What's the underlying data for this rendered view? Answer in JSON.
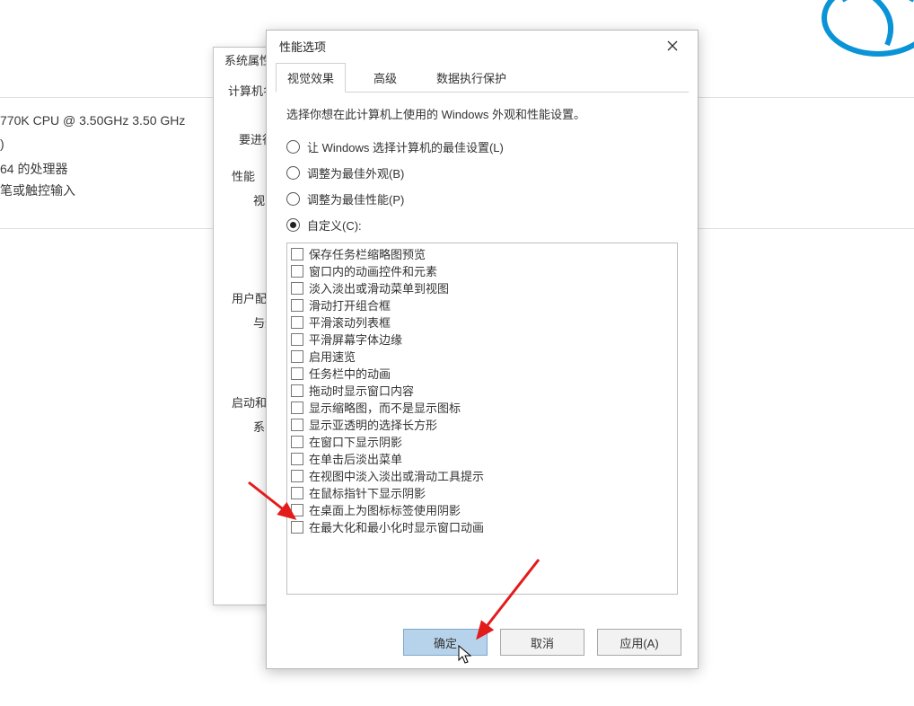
{
  "bg": {
    "cpu_line": "770K CPU @ 3.50GHz   3.50 GHz",
    "proc_line": "64 的处理器",
    "touch_line": "笔或触控输入"
  },
  "sysprops": {
    "title": "系统属性",
    "tab_computer": "计算机名",
    "need_line": "要进行",
    "perf_section": "性能",
    "perf_indent": "视觉",
    "user_section": "用户配",
    "user_indent": "与登",
    "startup_section": "启动和",
    "startup_indent": "系纟"
  },
  "perf": {
    "title": "性能选项",
    "tabs": {
      "visual": "视觉效果",
      "advanced": "高级",
      "dep": "数据执行保护"
    },
    "desc": "选择你想在此计算机上使用的 Windows 外观和性能设置。",
    "radios": {
      "auto": "让 Windows 选择计算机的最佳设置(L)",
      "best_look": "调整为最佳外观(B)",
      "best_perf": "调整为最佳性能(P)",
      "custom": "自定义(C):"
    },
    "options": [
      "保存任务栏缩略图预览",
      "窗口内的动画控件和元素",
      "淡入淡出或滑动菜单到视图",
      "滑动打开组合框",
      "平滑滚动列表框",
      "平滑屏幕字体边缘",
      "启用速览",
      "任务栏中的动画",
      "拖动时显示窗口内容",
      "显示缩略图，而不是显示图标",
      "显示亚透明的选择长方形",
      "在窗口下显示阴影",
      "在单击后淡出菜单",
      "在视图中淡入淡出或滑动工具提示",
      "在鼠标指针下显示阴影",
      "在桌面上为图标标签使用阴影",
      "在最大化和最小化时显示窗口动画"
    ],
    "buttons": {
      "ok": "确定",
      "cancel": "取消",
      "apply": "应用(A)"
    }
  }
}
